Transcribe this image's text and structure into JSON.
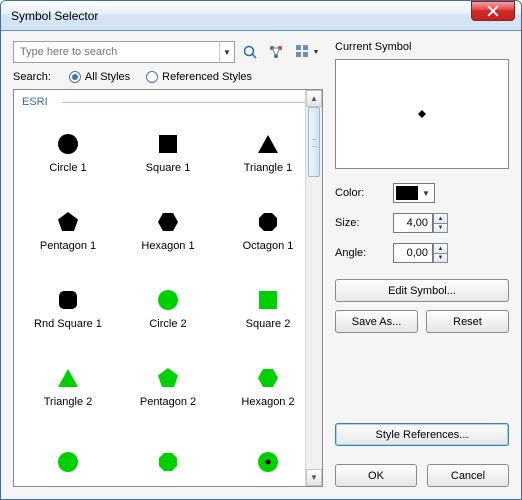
{
  "window": {
    "title": "Symbol Selector"
  },
  "search": {
    "placeholder": "Type here to search",
    "label": "Search:",
    "all_styles": "All Styles",
    "referenced_styles": "Referenced Styles"
  },
  "category": "ESRI",
  "symbols": [
    {
      "label": "Circle 1",
      "shape": "circle",
      "color": "#000000"
    },
    {
      "label": "Square 1",
      "shape": "square",
      "color": "#000000"
    },
    {
      "label": "Triangle 1",
      "shape": "triangle",
      "color": "#000000"
    },
    {
      "label": "Pentagon 1",
      "shape": "pentagon",
      "color": "#000000"
    },
    {
      "label": "Hexagon 1",
      "shape": "hexagon",
      "color": "#000000"
    },
    {
      "label": "Octagon 1",
      "shape": "octagon",
      "color": "#000000"
    },
    {
      "label": "Rnd Square 1",
      "shape": "rsquare",
      "color": "#000000"
    },
    {
      "label": "Circle 2",
      "shape": "circle",
      "color": "#00d000"
    },
    {
      "label": "Square 2",
      "shape": "square",
      "color": "#00d000"
    },
    {
      "label": "Triangle 2",
      "shape": "triangle",
      "color": "#00d000"
    },
    {
      "label": "Pentagon 2",
      "shape": "pentagon",
      "color": "#00d000"
    },
    {
      "label": "Hexagon 2",
      "shape": "hexagon",
      "color": "#00d000"
    },
    {
      "label": "",
      "shape": "circle",
      "color": "#00d000"
    },
    {
      "label": "",
      "shape": "octagon",
      "color": "#00d000"
    },
    {
      "label": "",
      "shape": "circledot",
      "color": "#00d000"
    }
  ],
  "current": {
    "title": "Current Symbol",
    "color_label": "Color:",
    "color_value": "#000000",
    "size_label": "Size:",
    "size_value": "4,00",
    "angle_label": "Angle:",
    "angle_value": "0,00"
  },
  "buttons": {
    "edit_symbol": "Edit Symbol...",
    "save_as": "Save As...",
    "reset": "Reset",
    "style_refs": "Style References...",
    "ok": "OK",
    "cancel": "Cancel"
  }
}
